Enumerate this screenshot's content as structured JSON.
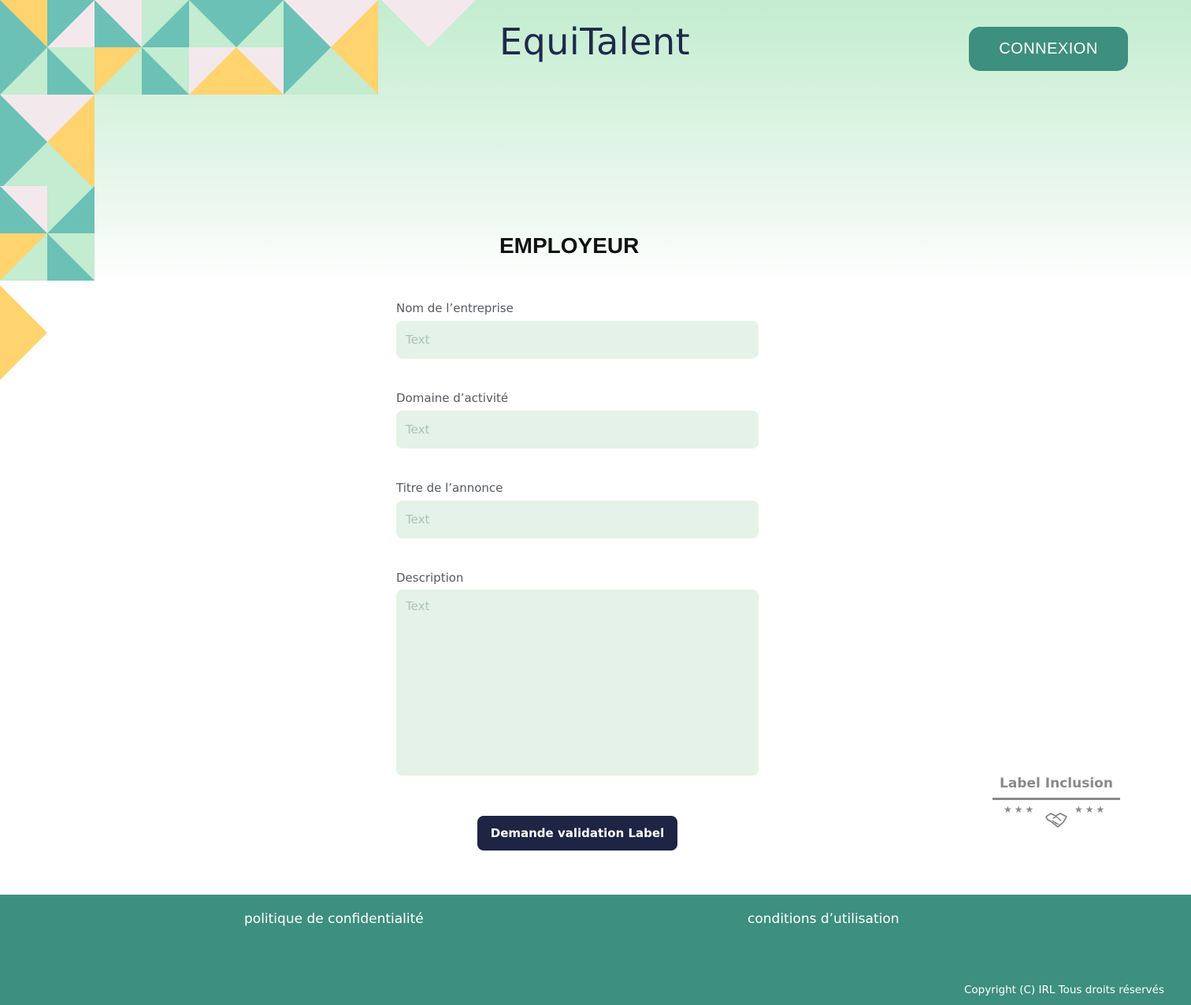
{
  "header": {
    "logo": "EquiTalent",
    "login_button": "CONNEXION"
  },
  "form": {
    "title": "EMPLOYEUR",
    "fields": [
      {
        "label": "Nom de l’entreprise",
        "placeholder": "Text",
        "value": ""
      },
      {
        "label": "Domaine d’activité",
        "placeholder": "Text",
        "value": ""
      },
      {
        "label": "Titre de l’annonce",
        "placeholder": "Text",
        "value": ""
      },
      {
        "label": "Description",
        "placeholder": "Text",
        "value": ""
      }
    ],
    "submit_button": "Demande validation Label"
  },
  "label_badge": {
    "title": "Label Inclusion",
    "stars_left": "★★★",
    "stars_right": "★★★",
    "icon": "handshake-icon"
  },
  "footer": {
    "privacy_link": "politique de confidentialité",
    "terms_link": "conditions d’utilisation",
    "copyright": "Copyright (C) IRL Tous droits réservés"
  },
  "colors": {
    "teal": "#3d8f7f",
    "navy": "#1e2444",
    "mint": "#c3ecd0",
    "input_bg": "#e5f2e7",
    "pattern_teal": "#6bc1b6",
    "pattern_yellow": "#ffd36e",
    "pattern_pink": "#f3e9ec",
    "pattern_lightgreen": "#c3ecd0"
  }
}
